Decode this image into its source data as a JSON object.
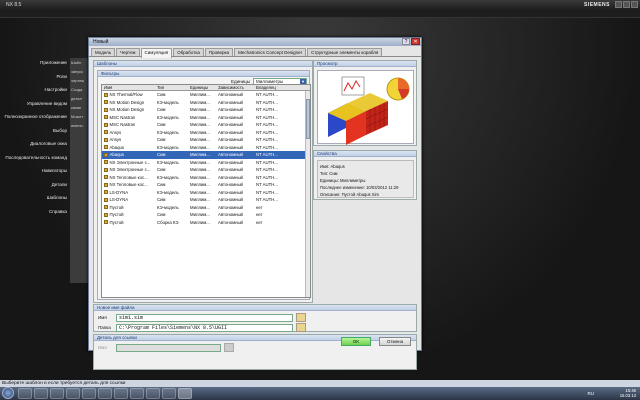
{
  "app": {
    "title": "NX 8.5",
    "brand": "SIEMENS"
  },
  "left_nav": [
    "Приложение",
    "Роли",
    "Настройки",
    "Управление видом",
    "Полноэкранное отображение",
    "Выбор",
    "Диалоговые окна",
    "Последовательность команд",
    "Навигаторы",
    "Детали",
    "Шаблоны",
    "Справка"
  ],
  "stripe_text": [
    "Шабл",
    "запуск",
    "чертеж",
    "Созда",
    "детал",
    "какие",
    "Может",
    "имени"
  ],
  "dialog": {
    "title": "Новый",
    "help": "?",
    "close": "✕",
    "tabs": [
      "Модель",
      "Чертеж",
      "Симуляция",
      "Обработка",
      "Проверка",
      "Mechatronics Concept Designer",
      "Структурные элементы корабля"
    ],
    "active_tab": 2,
    "templates_header": "Шаблоны",
    "filters_header": "Фильтры",
    "units_label": "Единицы",
    "units_value": "Миллиметры",
    "columns": [
      "Имя",
      "Тип",
      "Единицы",
      "Зависимость",
      "Владелец"
    ],
    "rows": [
      [
        "NX Thermal/Flow",
        "Сим",
        "Миллим...",
        "Автономный",
        "NT AUTH..."
      ],
      [
        "NX Motion Design",
        "КЭ-модель",
        "Миллим...",
        "Автономный",
        "NT AUTH..."
      ],
      [
        "NX Motion Design",
        "Сим",
        "Миллим...",
        "Автономный",
        "NT AUTH..."
      ],
      [
        "MSC Nastran",
        "КЭ-модель",
        "Миллим...",
        "Автономный",
        "NT AUTH..."
      ],
      [
        "MSC Nastran",
        "Сим",
        "Миллим...",
        "Автономный",
        "NT AUTH..."
      ],
      [
        "Ansys",
        "КЭ-модель",
        "Миллим...",
        "Автономный",
        "NT AUTH..."
      ],
      [
        "Ansys",
        "Сим",
        "Миллим...",
        "Автономный",
        "NT AUTH..."
      ],
      [
        "Abaqus",
        "КЭ-модель",
        "Миллим...",
        "Автономный",
        "NT AUTH..."
      ],
      [
        "Abaqus",
        "Сим",
        "Миллим...",
        "Автономный",
        "NT AUTH..."
      ],
      [
        "NX Электронные с...",
        "КЭ-модель",
        "Миллим...",
        "Автономный",
        "NT AUTH..."
      ],
      [
        "NX Электронные с...",
        "Сим",
        "Миллим...",
        "Автономный",
        "NT AUTH..."
      ],
      [
        "NX Тепловые кос...",
        "КЭ-модель",
        "Миллим...",
        "Автономный",
        "NT AUTH..."
      ],
      [
        "NX Тепловые кос...",
        "Сим",
        "Миллим...",
        "Автономный",
        "NT AUTH..."
      ],
      [
        "LS-DYNA",
        "КЭ-модель",
        "Миллим...",
        "Автономный",
        "NT AUTH..."
      ],
      [
        "LS-DYNA",
        "Сим",
        "Миллим...",
        "Автономный",
        "NT AUTH..."
      ],
      [
        "Пустой",
        "КЭ-модель",
        "Миллим...",
        "Автономный",
        "нет"
      ],
      [
        "Пустой",
        "Сим",
        "Миллим...",
        "Автономный",
        "нет"
      ],
      [
        "Пустой",
        "Сборка КЭ",
        "Миллим...",
        "Автономный",
        "нет"
      ]
    ],
    "selected_row": 8,
    "preview_header": "Просмотр",
    "props_header": "Свойства",
    "props": [
      "Имя: Abaqus",
      "Тип: Сим",
      "Единицы: Миллиметры",
      "Последнее изменение: 10/03/2012 11:29",
      "Описание: Пустой Abaqus Sim"
    ],
    "newfile_header": "Новое имя файла",
    "name_label": "Имя",
    "name_value": "sim1.sim",
    "folder_label": "Папка",
    "folder_value": "C:\\Program Files\\Siemens\\NX 8.5\\UGII",
    "detail_header": "Деталь для ссылки",
    "ok": "OK",
    "cancel": "Отмена"
  },
  "status_text": "Выберите шаблон и если требуется деталь для ссылки",
  "tray": {
    "lang": "RU",
    "time": "15:46",
    "date": "15.03.13"
  }
}
